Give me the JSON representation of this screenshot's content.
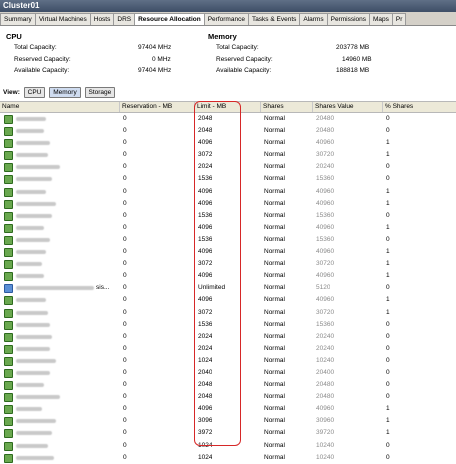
{
  "window": {
    "title": "Cluster01"
  },
  "tabs": [
    {
      "label": "Summary"
    },
    {
      "label": "Virtual Machines"
    },
    {
      "label": "Hosts"
    },
    {
      "label": "DRS"
    },
    {
      "label": "Resource Allocation",
      "active": true
    },
    {
      "label": "Performance"
    },
    {
      "label": "Tasks & Events"
    },
    {
      "label": "Alarms"
    },
    {
      "label": "Permissions"
    },
    {
      "label": "Maps"
    },
    {
      "label": "Pr"
    }
  ],
  "cpu": {
    "title": "CPU",
    "total_label": "Total Capacity:",
    "total_value": "97404 MHz",
    "reserved_label": "Reserved Capacity:",
    "reserved_value": "0 MHz",
    "available_label": "Available Capacity:",
    "available_value": "97404 MHz"
  },
  "memory": {
    "title": "Memory",
    "total_label": "Total Capacity:",
    "total_value": "203778 MB",
    "reserved_label": "Reserved Capacity:",
    "reserved_value": "14960 MB",
    "available_label": "Available Capacity:",
    "available_value": "188818 MB"
  },
  "view": {
    "label": "View:",
    "buttons": [
      "CPU",
      "Memory",
      "Storage"
    ],
    "selected": "Memory"
  },
  "table": {
    "headers": [
      "Name",
      "Reservation - MB",
      "Limit - MB",
      "Shares",
      "Shares Value",
      "% Shares"
    ],
    "rows": [
      {
        "reservation": "0",
        "limit": "2048",
        "shares": "Normal",
        "value": "20480",
        "pct": "0"
      },
      {
        "reservation": "0",
        "limit": "2048",
        "shares": "Normal",
        "value": "20480",
        "pct": "0"
      },
      {
        "reservation": "0",
        "limit": "4096",
        "shares": "Normal",
        "value": "40960",
        "pct": "1"
      },
      {
        "reservation": "0",
        "limit": "3072",
        "shares": "Normal",
        "value": "30720",
        "pct": "1"
      },
      {
        "reservation": "0",
        "limit": "2024",
        "shares": "Normal",
        "value": "20240",
        "pct": "0"
      },
      {
        "reservation": "0",
        "limit": "1536",
        "shares": "Normal",
        "value": "15360",
        "pct": "0"
      },
      {
        "reservation": "0",
        "limit": "4096",
        "shares": "Normal",
        "value": "40960",
        "pct": "1"
      },
      {
        "reservation": "0",
        "limit": "4096",
        "shares": "Normal",
        "value": "40960",
        "pct": "1"
      },
      {
        "reservation": "0",
        "limit": "1536",
        "shares": "Normal",
        "value": "15360",
        "pct": "0"
      },
      {
        "reservation": "0",
        "limit": "4096",
        "shares": "Normal",
        "value": "40960",
        "pct": "1"
      },
      {
        "reservation": "0",
        "limit": "1536",
        "shares": "Normal",
        "value": "15360",
        "pct": "0"
      },
      {
        "reservation": "0",
        "limit": "4096",
        "shares": "Normal",
        "value": "40960",
        "pct": "1"
      },
      {
        "reservation": "0",
        "limit": "3072",
        "shares": "Normal",
        "value": "30720",
        "pct": "1"
      },
      {
        "reservation": "0",
        "limit": "4096",
        "shares": "Normal",
        "value": "40960",
        "pct": "1"
      },
      {
        "name_suffix": "sis...",
        "reservation": "0",
        "limit": "Unlimited",
        "shares": "Normal",
        "value": "5120",
        "pct": "0",
        "alt": true
      },
      {
        "reservation": "0",
        "limit": "4096",
        "shares": "Normal",
        "value": "40960",
        "pct": "1"
      },
      {
        "reservation": "0",
        "limit": "3072",
        "shares": "Normal",
        "value": "30720",
        "pct": "1"
      },
      {
        "reservation": "0",
        "limit": "1536",
        "shares": "Normal",
        "value": "15360",
        "pct": "0"
      },
      {
        "reservation": "0",
        "limit": "2024",
        "shares": "Normal",
        "value": "20240",
        "pct": "0"
      },
      {
        "reservation": "0",
        "limit": "2024",
        "shares": "Normal",
        "value": "20240",
        "pct": "0"
      },
      {
        "reservation": "0",
        "limit": "1024",
        "shares": "Normal",
        "value": "10240",
        "pct": "0"
      },
      {
        "reservation": "0",
        "limit": "2040",
        "shares": "Normal",
        "value": "20400",
        "pct": "0"
      },
      {
        "reservation": "0",
        "limit": "2048",
        "shares": "Normal",
        "value": "20480",
        "pct": "0"
      },
      {
        "reservation": "0",
        "limit": "2048",
        "shares": "Normal",
        "value": "20480",
        "pct": "0"
      },
      {
        "reservation": "0",
        "limit": "4096",
        "shares": "Normal",
        "value": "40960",
        "pct": "1"
      },
      {
        "reservation": "0",
        "limit": "3096",
        "shares": "Normal",
        "value": "30960",
        "pct": "1"
      },
      {
        "reservation": "0",
        "limit": "3972",
        "shares": "Normal",
        "value": "39720",
        "pct": "1"
      },
      {
        "reservation": "0",
        "limit": "1024",
        "shares": "Normal",
        "value": "10240",
        "pct": "0"
      },
      {
        "reservation": "0",
        "limit": "1024",
        "shares": "Normal",
        "value": "10240",
        "pct": "0"
      }
    ]
  },
  "colors": {
    "highlight": "#d62828",
    "vm_icon": "#6aa84f"
  }
}
